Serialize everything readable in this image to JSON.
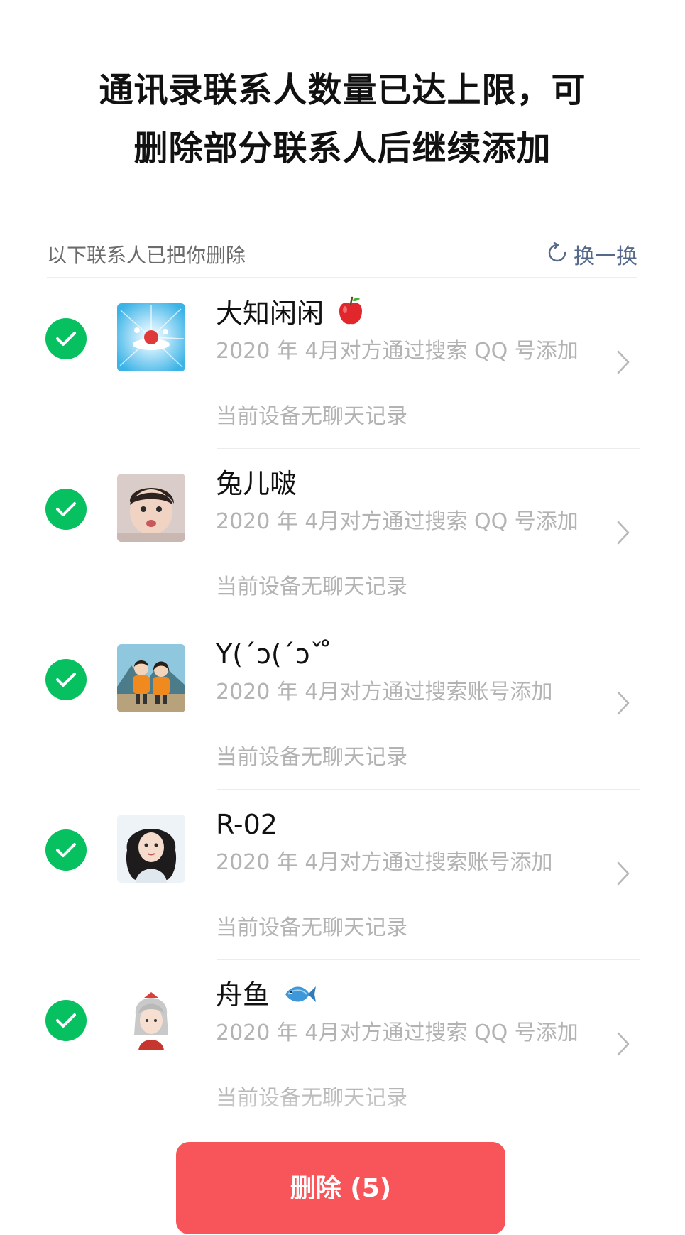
{
  "header": {
    "title_line1": "通讯录联系人数量已达上限，可",
    "title_line2": "删除部分联系人后继续添加"
  },
  "section": {
    "label": "以下联系人已把你删除",
    "refresh_label": "换一换",
    "refresh_icon": "refresh-icon"
  },
  "contacts": [
    {
      "name": "大知闲闲",
      "emoji": "apple-icon",
      "desc": "2020 年 4月对方通过搜索 QQ 号添加",
      "chat_note": "当前设备无聊天记录",
      "checked": true
    },
    {
      "name": "兔儿啵",
      "emoji": "",
      "desc": "2020 年 4月对方通过搜索 QQ 号添加",
      "chat_note": "当前设备无聊天记录",
      "checked": true
    },
    {
      "name": "Y(ˊɔ(ˊɔˇ ̊",
      "emoji": "",
      "desc": "2020 年 4月对方通过搜索账号添加",
      "chat_note": "当前设备无聊天记录",
      "checked": true
    },
    {
      "name": "R-02",
      "emoji": "",
      "desc": "2020 年 4月对方通过搜索账号添加",
      "chat_note": "当前设备无聊天记录",
      "checked": true
    },
    {
      "name": "舟鱼",
      "emoji": "fish-icon",
      "desc": "2020 年 4月对方通过搜索 QQ 号添加",
      "chat_note": "当前设备无聊天记录",
      "checked": true
    }
  ],
  "actions": {
    "delete_label": "删除 (5)"
  },
  "colors": {
    "accent_green": "#07c160",
    "delete_red": "#f7555a",
    "link_blue": "#55698b"
  }
}
